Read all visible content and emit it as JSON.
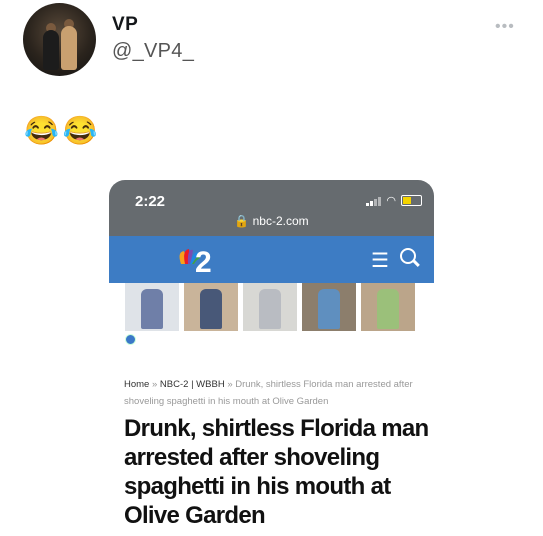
{
  "tweet": {
    "name": "VP",
    "handle": "@_VP4_",
    "text": "😂😂",
    "more_icon": "more-icon"
  },
  "phone": {
    "time": "2:22",
    "url": "nbc-2.com",
    "status_colors": {
      "bar": "#666b6f",
      "nav": "#3d7cc4"
    }
  },
  "article": {
    "breadcrumb": {
      "home": "Home",
      "section": "NBC-2 | WBBH",
      "current": "Drunk, shirtless Florida man arrested after shoveling spaghetti in his mouth at Olive Garden"
    },
    "headline": "Drunk, shirtless Florida man arrested after shoveling spaghetti in his mouth at Olive Garden"
  }
}
